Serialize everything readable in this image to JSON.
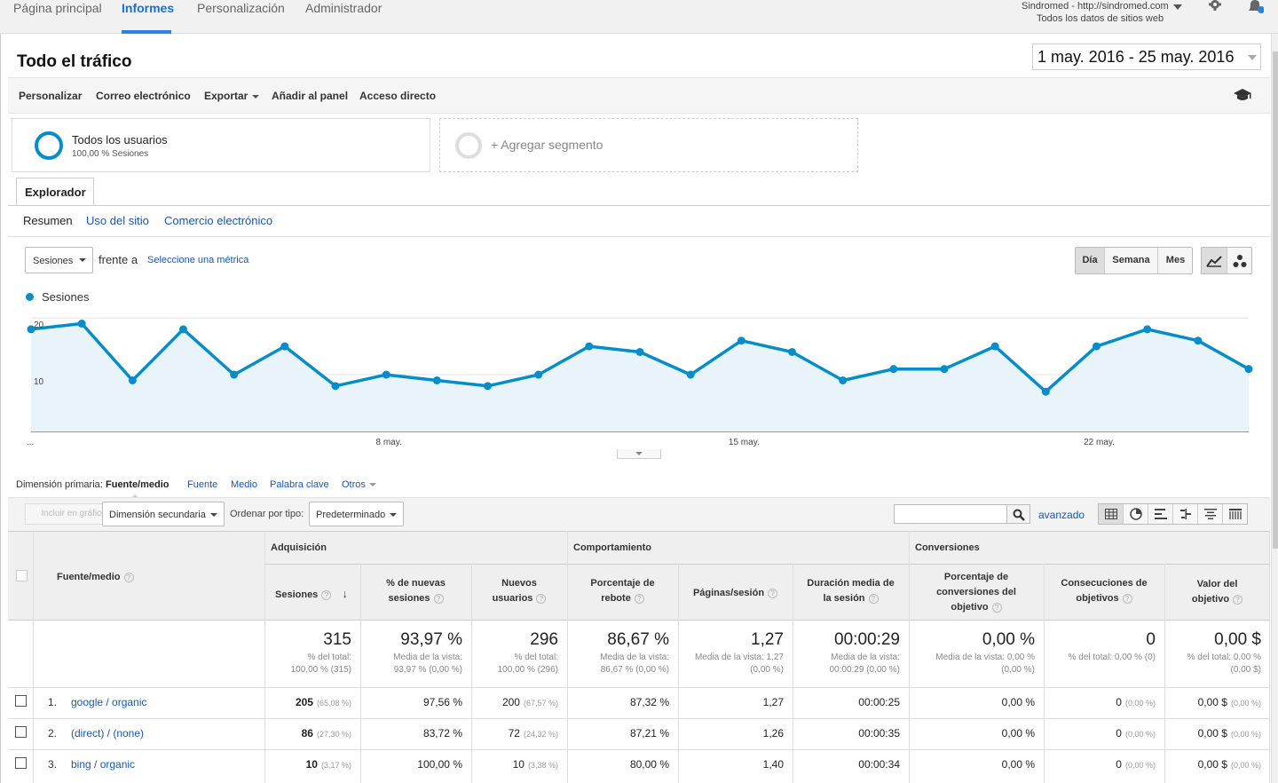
{
  "nav": {
    "items": [
      "Página principal",
      "Informes",
      "Personalización",
      "Administrador"
    ],
    "account_line1": "Sindromed - http://sindromed.com",
    "account_line2": "Todos los datos de sitios web"
  },
  "header": {
    "title": "Todo el tráfico",
    "date_range": "1 may. 2016 - 25 may. 2016"
  },
  "toolbar": {
    "customize": "Personalizar",
    "email": "Correo electrónico",
    "export": "Exportar",
    "add_dashboard": "Añadir al panel",
    "shortcut": "Acceso directo"
  },
  "segments": {
    "active_name": "Todos los usuarios",
    "active_sub": "100,00 % Sesiones",
    "add_label": "+ Agregar segmento"
  },
  "tabs": {
    "explorer": "Explorador",
    "subtabs": [
      "Resumen",
      "Uso del sitio",
      "Comercio electrónico"
    ]
  },
  "chart_controls": {
    "metric": "Sesiones",
    "versus": "frente a",
    "select_metric": "Seleccione una métrica",
    "periods": [
      "Día",
      "Semana",
      "Mes"
    ]
  },
  "chart_data": {
    "type": "line",
    "series": [
      {
        "name": "Sesiones",
        "values": [
          18,
          19,
          9,
          18,
          10,
          15,
          8,
          10,
          9,
          8,
          10,
          15,
          14,
          10,
          16,
          14,
          9,
          11,
          11,
          15,
          7,
          15,
          18,
          16,
          11
        ]
      }
    ],
    "yticks": [
      10,
      20
    ],
    "xlabels": [
      "...",
      "8 may.",
      "15 may.",
      "22 may."
    ],
    "ylim": [
      0,
      20
    ],
    "legend": "top-left",
    "color": "#058dc7"
  },
  "dimensions": {
    "label": "Dimensión primaria:",
    "active": "Fuente/medio",
    "others": [
      "Fuente",
      "Medio",
      "Palabra clave",
      "Otros"
    ]
  },
  "table_controls": {
    "plot_rows": "Incluir en gráfico",
    "secondary_dim": "Dimensión secundaria",
    "sort_label": "Ordenar por tipo:",
    "sort_value": "Predeterminado",
    "advanced": "avanzado"
  },
  "table": {
    "groups": [
      "Adquisición",
      "Comportamiento",
      "Conversiones"
    ],
    "dim_header": "Fuente/medio",
    "columns": [
      "Sesiones",
      "% de nuevas sesiones",
      "Nuevos usuarios",
      "Porcentaje de rebote",
      "Páginas/sesión",
      "Duración media de la sesión",
      "Porcentaje de conversiones del objetivo",
      "Consecuciones de objetivos",
      "Valor del objetivo"
    ],
    "totals": [
      {
        "value": "315",
        "sub1": "% del total:",
        "sub2": "100,00 % (315)"
      },
      {
        "value": "93,97 %",
        "sub1": "Media de la vista:",
        "sub2": "93,97 % (0,00 %)"
      },
      {
        "value": "296",
        "sub1": "% del total:",
        "sub2": "100,00 % (296)"
      },
      {
        "value": "86,67 %",
        "sub1": "Media de la vista:",
        "sub2": "86,67 % (0,00 %)"
      },
      {
        "value": "1,27",
        "sub1": "Media de la vista: 1,27",
        "sub2": "(0,00 %)"
      },
      {
        "value": "00:00:29",
        "sub1": "Media de la vista:",
        "sub2": "00:00:29 (0,00 %)"
      },
      {
        "value": "0,00 %",
        "sub1": "Media de la vista: 0,00 %",
        "sub2": "(0,00 %)"
      },
      {
        "value": "0",
        "sub1": "% del total: 0,00 % (0)",
        "sub2": ""
      },
      {
        "value": "0,00 $",
        "sub1": "% del total: 0,00 %",
        "sub2": "(0,00 $)"
      }
    ],
    "rows": [
      {
        "num": "1.",
        "source": "google / organic",
        "cells": [
          {
            "v": "205",
            "p": "(65,08 %)"
          },
          {
            "v": "97,56 %",
            "p": ""
          },
          {
            "v": "200",
            "p": "(67,57 %)"
          },
          {
            "v": "87,32 %",
            "p": ""
          },
          {
            "v": "1,27",
            "p": ""
          },
          {
            "v": "00:00:25",
            "p": ""
          },
          {
            "v": "0,00 %",
            "p": ""
          },
          {
            "v": "0",
            "p": "(0,00 %)"
          },
          {
            "v": "0,00 $",
            "p": "(0,00 %)"
          }
        ]
      },
      {
        "num": "2.",
        "source": "(direct) / (none)",
        "cells": [
          {
            "v": "86",
            "p": "(27,30 %)"
          },
          {
            "v": "83,72 %",
            "p": ""
          },
          {
            "v": "72",
            "p": "(24,32 %)"
          },
          {
            "v": "87,21 %",
            "p": ""
          },
          {
            "v": "1,26",
            "p": ""
          },
          {
            "v": "00:00:35",
            "p": ""
          },
          {
            "v": "0,00 %",
            "p": ""
          },
          {
            "v": "0",
            "p": "(0,00 %)"
          },
          {
            "v": "0,00 $",
            "p": "(0,00 %)"
          }
        ]
      },
      {
        "num": "3.",
        "source": "bing / organic",
        "cells": [
          {
            "v": "10",
            "p": "(3,17 %)"
          },
          {
            "v": "100,00 %",
            "p": ""
          },
          {
            "v": "10",
            "p": "(3,38 %)"
          },
          {
            "v": "80,00 %",
            "p": ""
          },
          {
            "v": "1,40",
            "p": ""
          },
          {
            "v": "00:00:34",
            "p": ""
          },
          {
            "v": "0,00 %",
            "p": ""
          },
          {
            "v": "0",
            "p": "(0,00 %)"
          },
          {
            "v": "0,00 $",
            "p": "(0,00 %)"
          }
        ]
      }
    ]
  }
}
